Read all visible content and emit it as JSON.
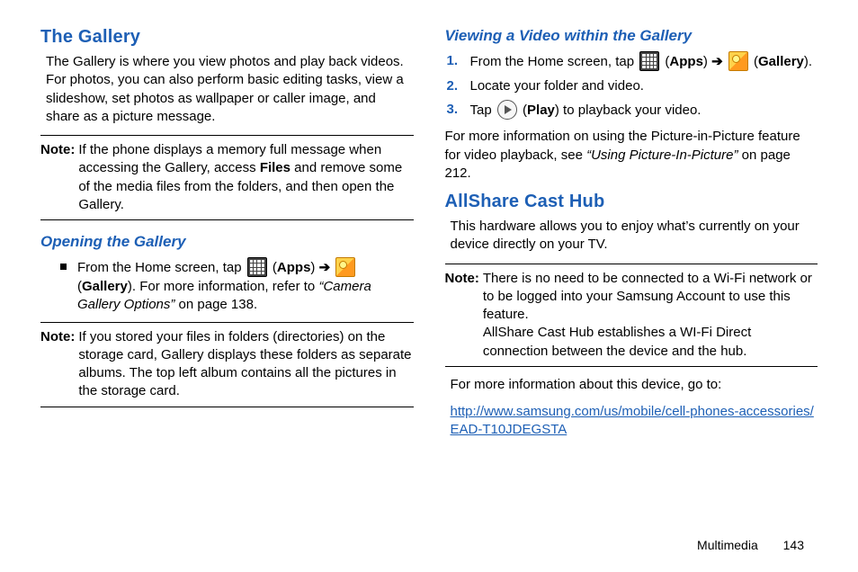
{
  "left": {
    "h_gallery": "The Gallery",
    "gallery_intro": "The Gallery is where you view photos and play back videos. For photos, you can also perform basic editing tasks, view a slideshow, set photos as wallpaper or caller image, and share as a picture message.",
    "note1_label": "Note:",
    "note1_pre": "If the phone displays a memory full message when accessing the Gallery, access ",
    "note1_bold": "Files",
    "note1_post": " and remove some of the media files from the folders, and then open the Gallery.",
    "h_opening": "Opening the Gallery",
    "open_pre": "From the Home screen, tap ",
    "open_apps": "Apps",
    "open_arrow": "➔",
    "open_gal_label": "Gallery",
    "open_post1": "). For more information, refer to ",
    "open_ref": "“Camera Gallery Options”",
    "open_post2": "  on page 138.",
    "note2_label": "Note:",
    "note2_text": "If you stored your files in folders (directories) on the storage card, Gallery displays these folders as separate albums. The top left album contains all the pictures in the storage card."
  },
  "right": {
    "h_viewing": "Viewing a Video within the Gallery",
    "step1_pre": "From the Home screen, tap ",
    "step1_apps": "Apps",
    "step1_arrow": "➔",
    "step1_gal": "Gallery",
    "step2": "Locate your folder and video.",
    "step3_pre": "Tap ",
    "step3_play": "Play",
    "step3_post": ") to playback your video.",
    "pip_pre": "For more information on using the Picture-in-Picture feature for video playback, see ",
    "pip_ref": "“Using Picture-In-Picture”",
    "pip_post": " on page 212.",
    "h_allshare": "AllShare Cast Hub",
    "allshare_intro": "This hardware allows you to enjoy what’s currently on your device directly on your TV.",
    "note3_label": "Note:",
    "note3_text1": "There is no need to be connected to a Wi-Fi network or to be logged into your Samsung Account to use this feature.",
    "note3_text2": "AllShare Cast Hub establishes a WI-Fi Direct connection between the device and the hub.",
    "more_info": "For more information about this device, go to:",
    "url": "http://www.samsung.com/us/mobile/cell-phones-accessories/EAD-T10JDEGSTA"
  },
  "footer": {
    "section": "Multimedia",
    "page": "143"
  },
  "nums": {
    "n1": "1.",
    "n2": "2.",
    "n3": "3."
  }
}
